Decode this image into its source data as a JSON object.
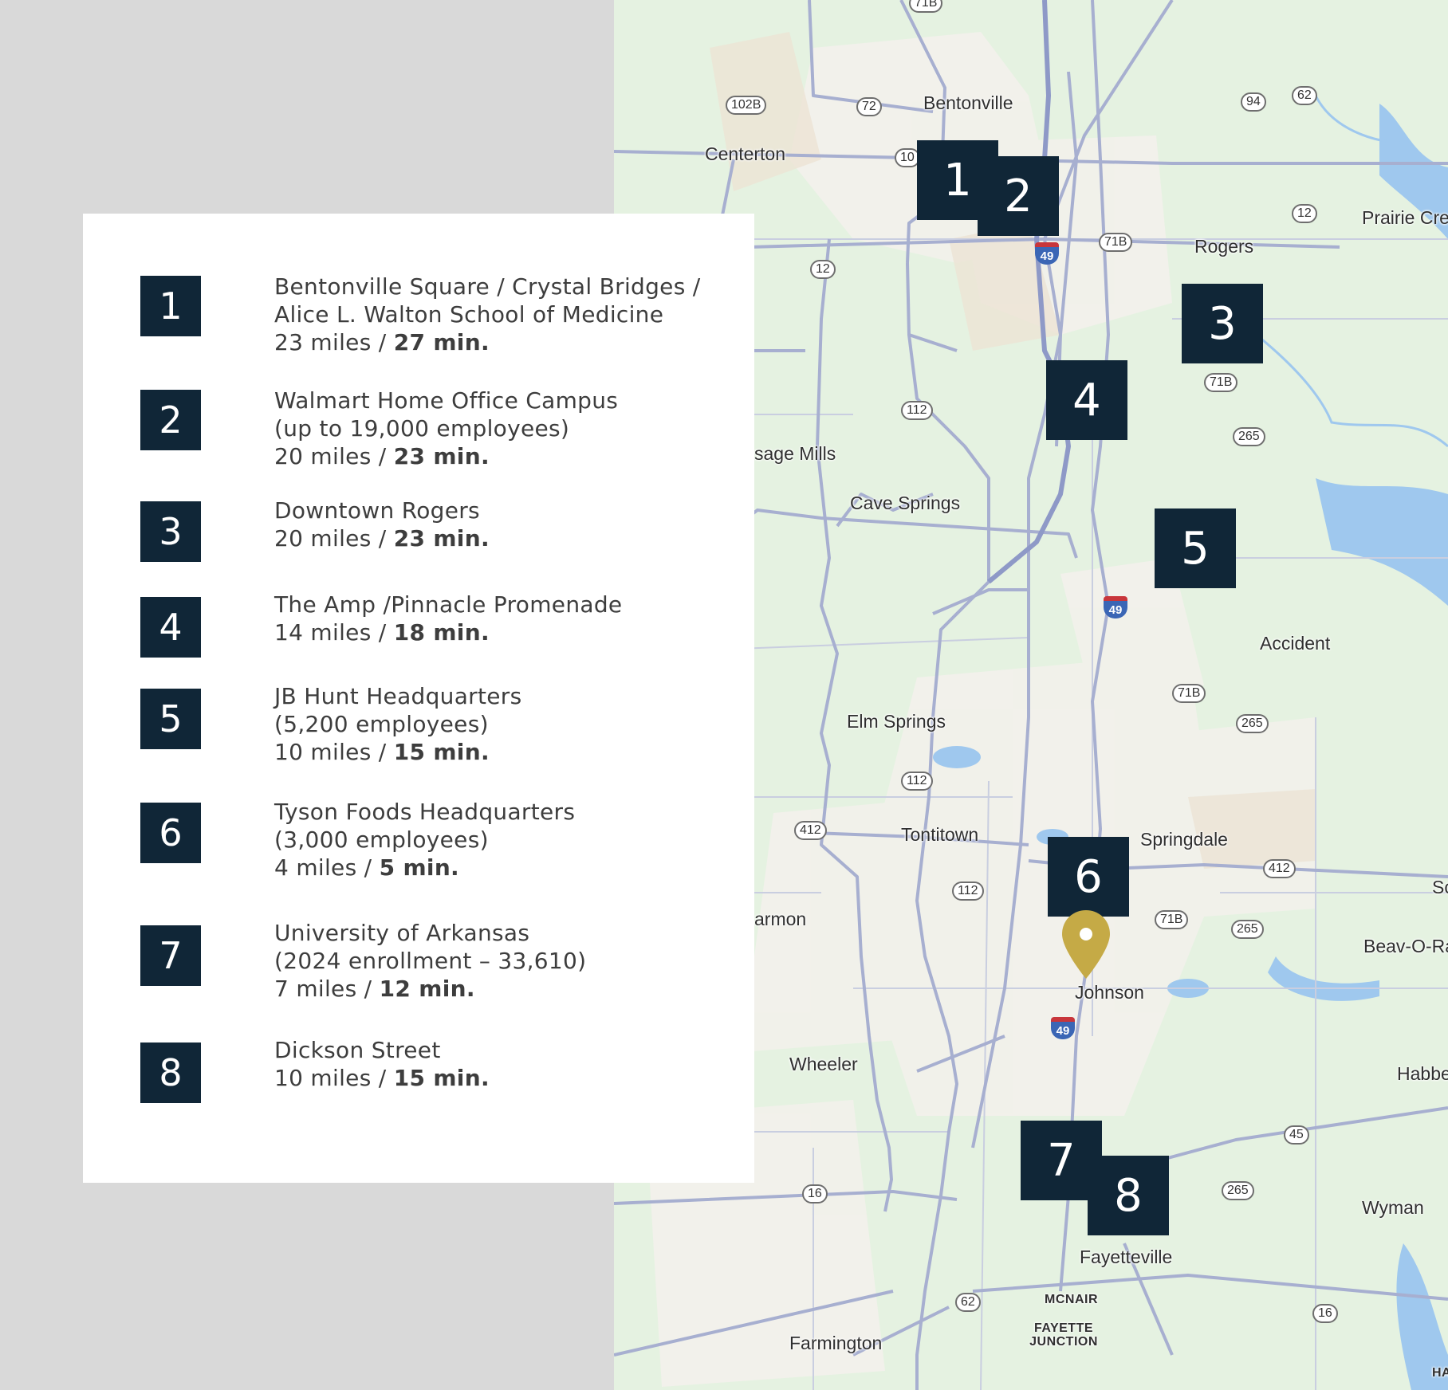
{
  "colors": {
    "marker": "#102637",
    "pin": "#c5aa46",
    "map_background": "#e5f2e1",
    "road": "#a7afd0"
  },
  "legend": [
    {
      "number": "1",
      "lines": [
        "Bentonville Square / Crystal Bridges /",
        "Alice L. Walton School of Medicine"
      ],
      "distance": "23 miles / ",
      "time": "27 min."
    },
    {
      "number": "2",
      "lines": [
        "Walmart Home Office Campus",
        "(up to 19,000 employees)"
      ],
      "distance": "20 miles / ",
      "time": "23 min."
    },
    {
      "number": "3",
      "lines": [
        "Downtown Rogers"
      ],
      "distance": "20 miles / ",
      "time": "23 min."
    },
    {
      "number": "4",
      "lines": [
        "The Amp /Pinnacle Promenade"
      ],
      "distance": "14 miles / ",
      "time": "18 min."
    },
    {
      "number": "5",
      "lines": [
        "JB Hunt Headquarters",
        "(5,200 employees)"
      ],
      "distance": "10 miles / ",
      "time": "15 min."
    },
    {
      "number": "6",
      "lines": [
        "Tyson Foods Headquarters",
        "(3,000 employees)"
      ],
      "distance": "4 miles / ",
      "time": "5 min."
    },
    {
      "number": "7",
      "lines": [
        "University of Arkansas",
        "(2024 enrollment – 33,610)"
      ],
      "distance": "7 miles / ",
      "time": "12 min."
    },
    {
      "number": "8",
      "lines": [
        "Dickson Street"
      ],
      "distance": "10 miles / ",
      "time": "15 min."
    }
  ],
  "map": {
    "places": [
      "Bentonville",
      "Centerton",
      "Rogers",
      "Prairie Cre",
      "sage Mills",
      "Cave Springs",
      "Accident",
      "Elm Springs",
      "Tontitown",
      "Springdale",
      "Sc",
      "armon",
      "Beav-O-Ra",
      "Johnson",
      "Wheeler",
      "Habbe",
      "Wyman",
      "Fayetteville",
      "MCNAIR",
      "FAYETTE JUNCTION",
      "Farmington",
      "HA"
    ],
    "route_shields": [
      "71B",
      "102B",
      "72",
      "10",
      "94",
      "62",
      "12",
      "12",
      "71B",
      "112",
      "71B",
      "265",
      "71B",
      "265",
      "112",
      "412",
      "112",
      "412",
      "71B",
      "265",
      "45",
      "16",
      "265",
      "62",
      "16"
    ],
    "interstate_label": "49",
    "markers": [
      "1",
      "2",
      "3",
      "4",
      "5",
      "6",
      "7",
      "8"
    ]
  }
}
